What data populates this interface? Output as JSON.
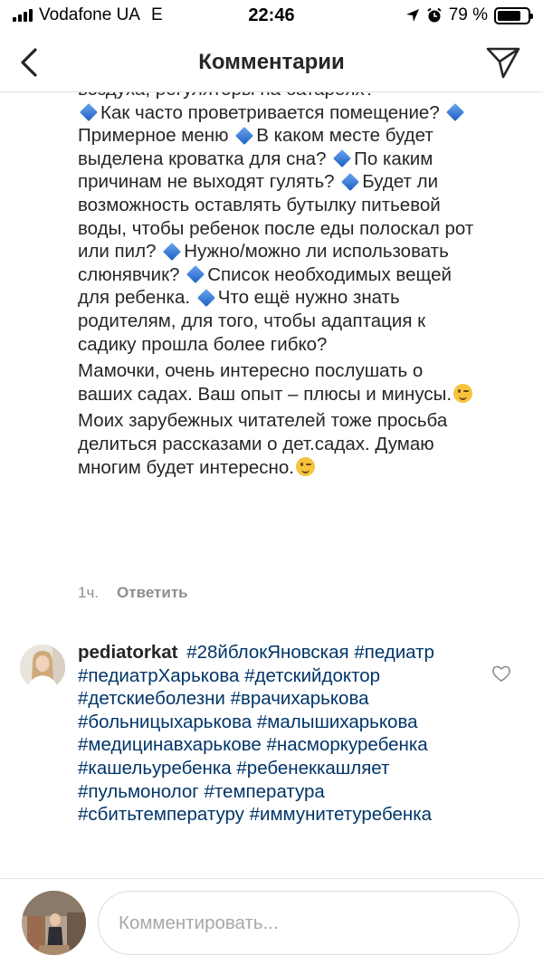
{
  "status_bar": {
    "carrier": "Vodafone UA",
    "network": "E",
    "time": "22:46",
    "battery": "79 %",
    "battery_level": 0.79
  },
  "nav": {
    "title": "Комментарии",
    "back_icon": "chevron-left-icon",
    "share_icon": "paper-plane-icon"
  },
  "comment": {
    "cut_line": "воздуха, регуляторы на батареях?",
    "q_airing": "Как часто проветривается помещение?",
    "q_menu": "Примерное меню",
    "q_bed": "В каком месте будет выделена кроватка для сна?",
    "q_walk": "По каким причинам не выходят гулять?",
    "q_water": "Будет ли возможность оставлять бутылку питьевой воды, чтобы ребенок после еды полоскал рот или пил?",
    "q_bib": "Нужно/можно ли использовать слюнявчик?",
    "q_list": "Список необходимых вещей для ребенка.",
    "q_else": "Что ещё нужно знать родителям, для того, чтобы адаптация к садику прошла более гибко?",
    "para_moms": "Мамочки, очень интересно послушать о ваших садах. Ваш опыт – плюсы и минусы.",
    "para_foreign": "Моих зарубежных читателей тоже просьба делиться рассказами о дет.садах. Думаю многим будет интересно.",
    "time": "1ч.",
    "reply_label": "Ответить"
  },
  "second_comment": {
    "username": "pediatorkat",
    "hashtags": [
      "#28йблокЯновская",
      "#педиатр",
      "#педиатрХарькова",
      "#детскийдоктор",
      "#детскиеболезни",
      "#врачихарькова",
      "#больницыхарькова",
      "#малышихарькова",
      "#медицинавхарькове",
      "#насморкуребенка",
      "#кашельуребенка",
      "#ребенеккашляет",
      "#пульмонолог",
      "#температура",
      "#сбитьтемпературу",
      "#иммунитетуребенка"
    ],
    "like_icon": "heart-outline-icon"
  },
  "bottom": {
    "input_placeholder": "Комментировать..."
  },
  "colors": {
    "text": "#262626",
    "muted": "#8e8e8e",
    "hashtag": "#003569",
    "diamond": "#2f6fd6"
  }
}
